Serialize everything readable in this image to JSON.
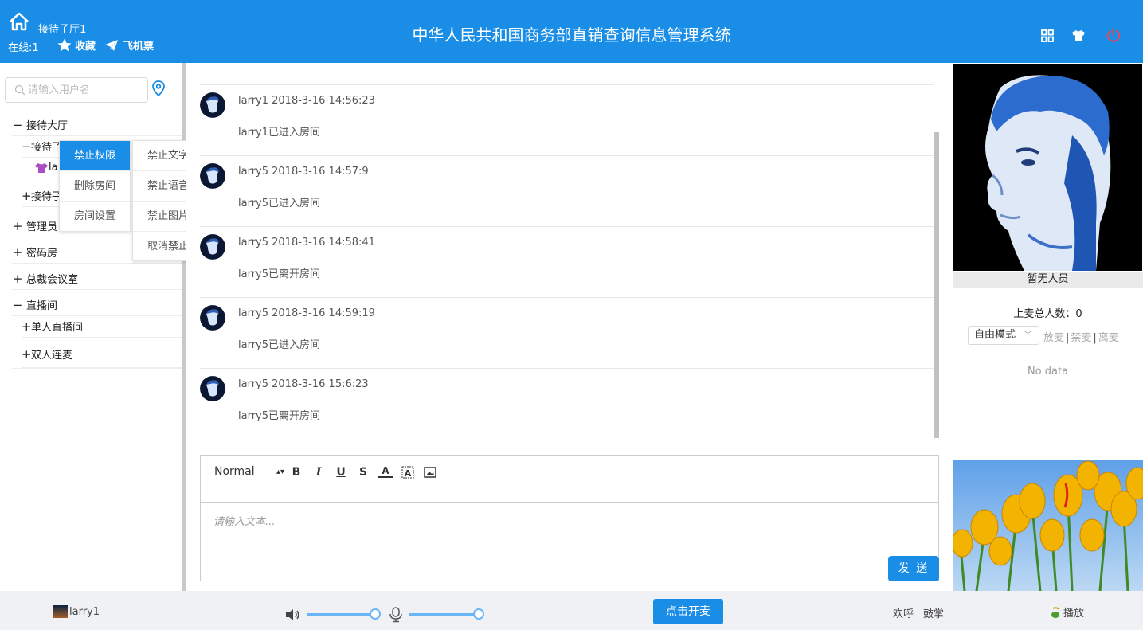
{
  "header": {
    "room_name": "接待子厅1",
    "online": "在线:1",
    "favorite_label": "收藏",
    "ticket_label": "飞机票",
    "title": "中华人民共和国商务部直销查询信息管理系统"
  },
  "sidebar": {
    "search_placeholder": "请输入用户名",
    "tree": [
      {
        "sign": "−",
        "label": "接待大厅"
      },
      {
        "sign": "−",
        "label": "接待子"
      },
      {
        "sign": "",
        "label": "la"
      },
      {
        "sign": "+",
        "label": "接待子"
      },
      {
        "sign": "+",
        "label": "管理员"
      },
      {
        "sign": "+",
        "label": "密码房"
      },
      {
        "sign": "+",
        "label": "总裁会议室"
      },
      {
        "sign": "−",
        "label": "直播间"
      },
      {
        "sign": "+",
        "label": "单人直播间"
      },
      {
        "sign": "+",
        "label": "双人连麦"
      }
    ]
  },
  "context_menu": {
    "primary": [
      "禁止权限",
      "删除房间",
      "房间设置"
    ],
    "secondary": [
      "禁止文字",
      "禁止语音",
      "禁止图片",
      "取消禁止"
    ]
  },
  "messages": [
    {
      "meta": "larry1 2018-3-16 14:56:23",
      "text": "larry1已进入房间"
    },
    {
      "meta": "larry5 2018-3-16 14:57:9",
      "text": "larry5已进入房间"
    },
    {
      "meta": "larry5 2018-3-16 14:58:41",
      "text": "larry5已离开房间"
    },
    {
      "meta": "larry5 2018-3-16 14:59:19",
      "text": "larry5已进入房间"
    },
    {
      "meta": "larry5 2018-3-16 15:6:23",
      "text": "larry5已离开房间"
    }
  ],
  "editor": {
    "format_label": "Normal",
    "placeholder": "请输入文本...",
    "send_label": "发 送"
  },
  "right_panel": {
    "no_people": "暂无人员",
    "mic_count": "上麦总人数：0",
    "mode": "自由模式",
    "actions": [
      "放麦",
      "禁麦",
      "离麦"
    ],
    "no_data": "No data"
  },
  "footer": {
    "user": "larry1",
    "volume_level": 1.0,
    "mic_level": 1.0,
    "open_mic_label": "点击开麦",
    "cheer_label": "欢呼",
    "clap_label": "鼓掌",
    "play_label": "播放"
  },
  "colors": {
    "brand": "#1a8de6",
    "slider": "#6ab5f8",
    "power": "#e8455b"
  }
}
